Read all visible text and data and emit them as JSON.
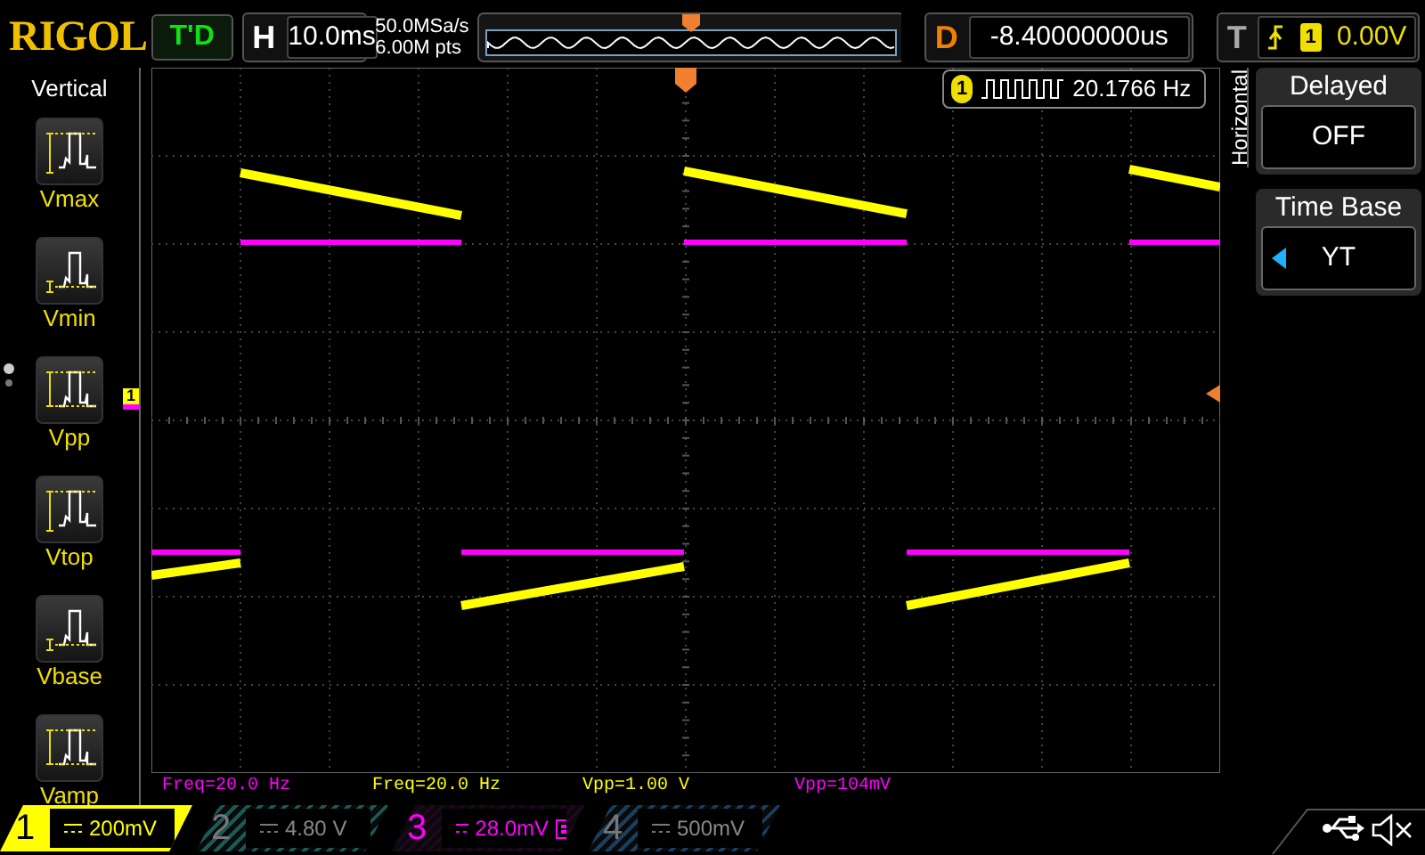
{
  "brand": "RIGOL",
  "run_state": "T'D",
  "timebase": {
    "label": "H",
    "value": "10.0ms"
  },
  "acquisition": {
    "sample_rate": "50.0MSa/s",
    "memory_depth": "6.00M pts"
  },
  "delay": {
    "label": "D",
    "value": "-8.40000000us"
  },
  "trigger": {
    "label": "T",
    "source": "1",
    "level": "0.00V"
  },
  "measure_menu": {
    "title": "Vertical",
    "items": [
      {
        "kind": "max",
        "label": "Vmax"
      },
      {
        "kind": "min",
        "label": "Vmin"
      },
      {
        "kind": "pp",
        "label": "Vpp"
      },
      {
        "kind": "top",
        "label": "Vtop"
      },
      {
        "kind": "base",
        "label": "Vbase"
      },
      {
        "kind": "amp",
        "label": "Vamp"
      }
    ]
  },
  "channel_marker": "1",
  "frequency_counter": {
    "source": "1",
    "value": "20.1766 Hz"
  },
  "horizontal_menu": {
    "title": "Horizontal",
    "items": [
      {
        "label": "Delayed",
        "value": "OFF",
        "selected": false
      },
      {
        "label": "Time Base",
        "value": "YT",
        "selected": true
      }
    ]
  },
  "measurements": [
    {
      "text": "Freq=20.0 Hz",
      "color": "#ff00ff"
    },
    {
      "text": "Freq=20.0 Hz",
      "color": "#ffff00"
    },
    {
      "text": "Vpp=1.00 V",
      "color": "#ffff00"
    },
    {
      "text": "Vpp=104mV",
      "color": "#ff00ff"
    }
  ],
  "channels": [
    {
      "number": "1",
      "scale": "200mV",
      "on": true,
      "bw_limit": false,
      "color": "#ffff00"
    },
    {
      "number": "2",
      "scale": "4.80 V",
      "on": false,
      "bw_limit": false,
      "color": "#1a5a56"
    },
    {
      "number": "3",
      "scale": "28.0mV",
      "on": true,
      "bw_limit": true,
      "color": "#ff00ff"
    },
    {
      "number": "4",
      "scale": "500mV",
      "on": false,
      "bw_limit": false,
      "color": "#1a3e60"
    }
  ]
}
